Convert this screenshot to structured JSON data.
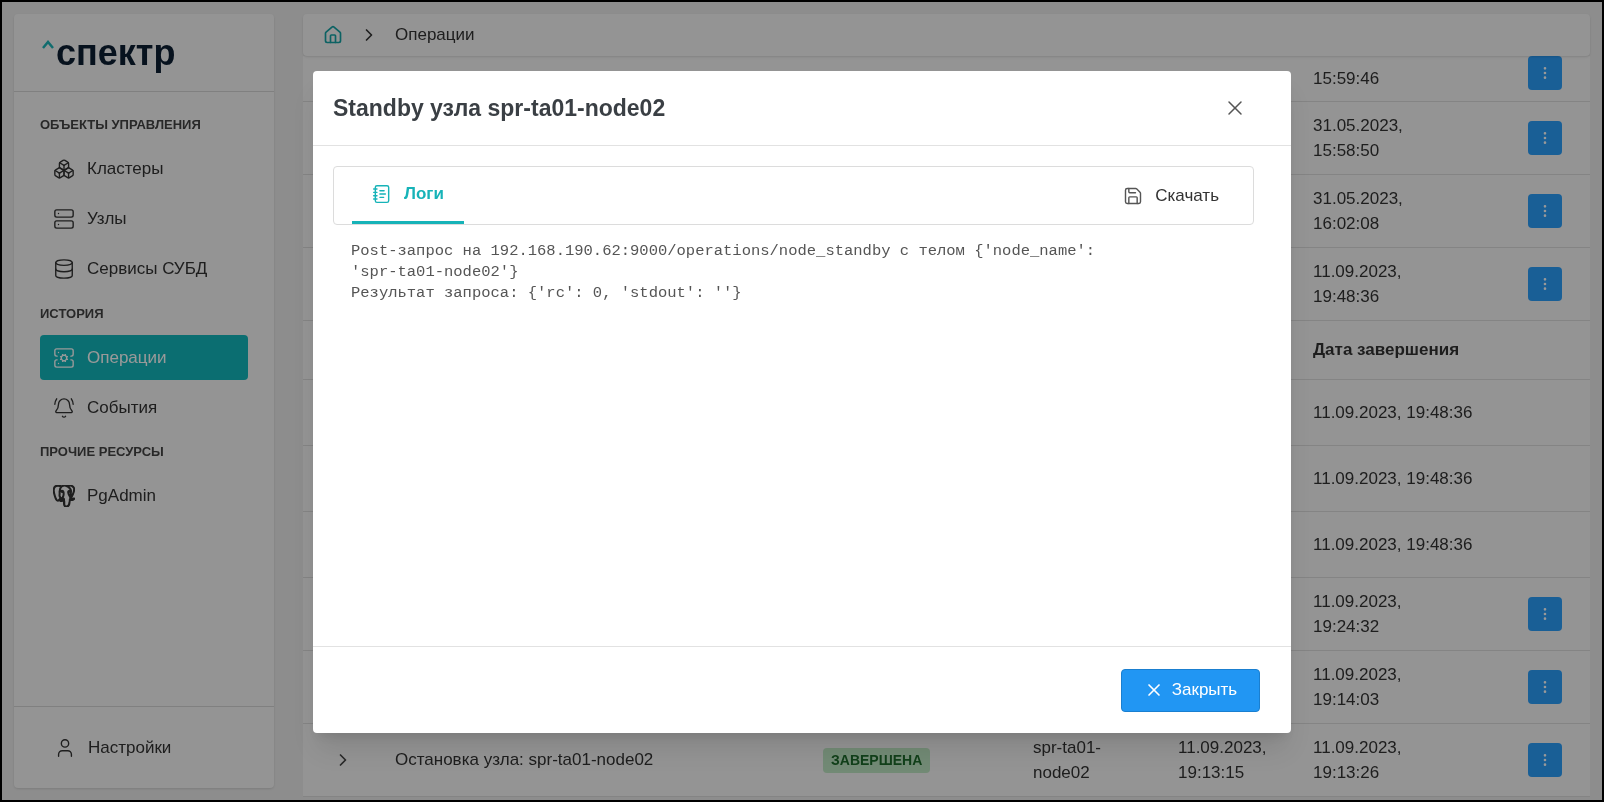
{
  "sidebar": {
    "logo": "спектр",
    "sections": [
      {
        "title": "ОБЪЕКТЫ УПРАВЛЕНИЯ",
        "items": [
          {
            "label": "Кластеры",
            "kind": "cluster",
            "selected": false
          },
          {
            "label": "Узлы",
            "kind": "server",
            "selected": false
          },
          {
            "label": "Сервисы СУБД",
            "kind": "database",
            "selected": false
          }
        ]
      },
      {
        "title": "ИСТОРИЯ",
        "items": [
          {
            "label": "Операции",
            "kind": "operations",
            "selected": true
          },
          {
            "label": "События",
            "kind": "bell",
            "selected": false
          }
        ]
      },
      {
        "title": "ПРОЧИЕ РЕСУРСЫ",
        "items": [
          {
            "label": "PgAdmin",
            "kind": "elephant",
            "selected": false
          }
        ]
      }
    ],
    "footer_item": {
      "label": "Настройки"
    }
  },
  "breadcrumb": {
    "items": [
      "Операции"
    ]
  },
  "table": {
    "rows": [
      {
        "kind": "row",
        "end_date": "15:59:46"
      },
      {
        "kind": "row",
        "end_date": "31.05.2023,\n15:58:50"
      },
      {
        "kind": "row",
        "end_date": "31.05.2023,\n16:02:08"
      },
      {
        "kind": "row",
        "end_date": "11.09.2023,\n19:48:36"
      },
      {
        "kind": "header",
        "end_date": "Дата завершения"
      },
      {
        "kind": "subrow",
        "end_date": "11.09.2023, 19:48:36"
      },
      {
        "kind": "subrow",
        "end_date": "11.09.2023, 19:48:36"
      },
      {
        "kind": "subrow",
        "end_date": "11.09.2023, 19:48:36"
      },
      {
        "kind": "row",
        "end_date": "11.09.2023,\n19:24:32"
      },
      {
        "kind": "row",
        "end_date": "11.09.2023,\n19:14:03"
      },
      {
        "kind": "row",
        "name": "Остановка узла: spr-ta01-node02",
        "status": "ЗАВЕРШЕНА",
        "node": "spr-ta01-\nnode02",
        "start_date": "11.09.2023,\n19:13:15",
        "end_date": "11.09.2023,\n19:13:26"
      }
    ]
  },
  "dialog": {
    "title": "Standby узла spr-ta01-node02",
    "tabs": [
      {
        "label": "Логи",
        "selected": true
      }
    ],
    "download": "Скачать",
    "log": "Post-запрос на 192.168.190.62:9000/operations/node_standby с телом {'node_name':\n'spr-ta01-node02'}\nРезультат запроса: {'rc': 0, 'stdout': ''}",
    "close_button": "Закрыть"
  }
}
